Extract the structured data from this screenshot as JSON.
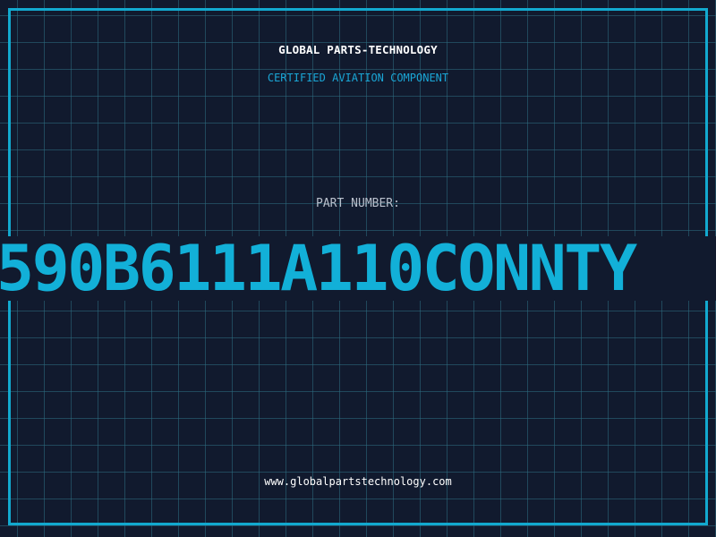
{
  "header": {
    "company": "GLOBAL PARTS-TECHNOLOGY",
    "certification": "CERTIFIED AVIATION COMPONENT"
  },
  "part": {
    "label": "PART NUMBER:",
    "number": "590B6111A110CONNTY"
  },
  "footer": {
    "url": "www.globalpartstechnology.com"
  },
  "colors": {
    "background": "#111a2e",
    "accent": "#12b0d8",
    "grid": "#2d6e82",
    "text": "#ffffff"
  }
}
